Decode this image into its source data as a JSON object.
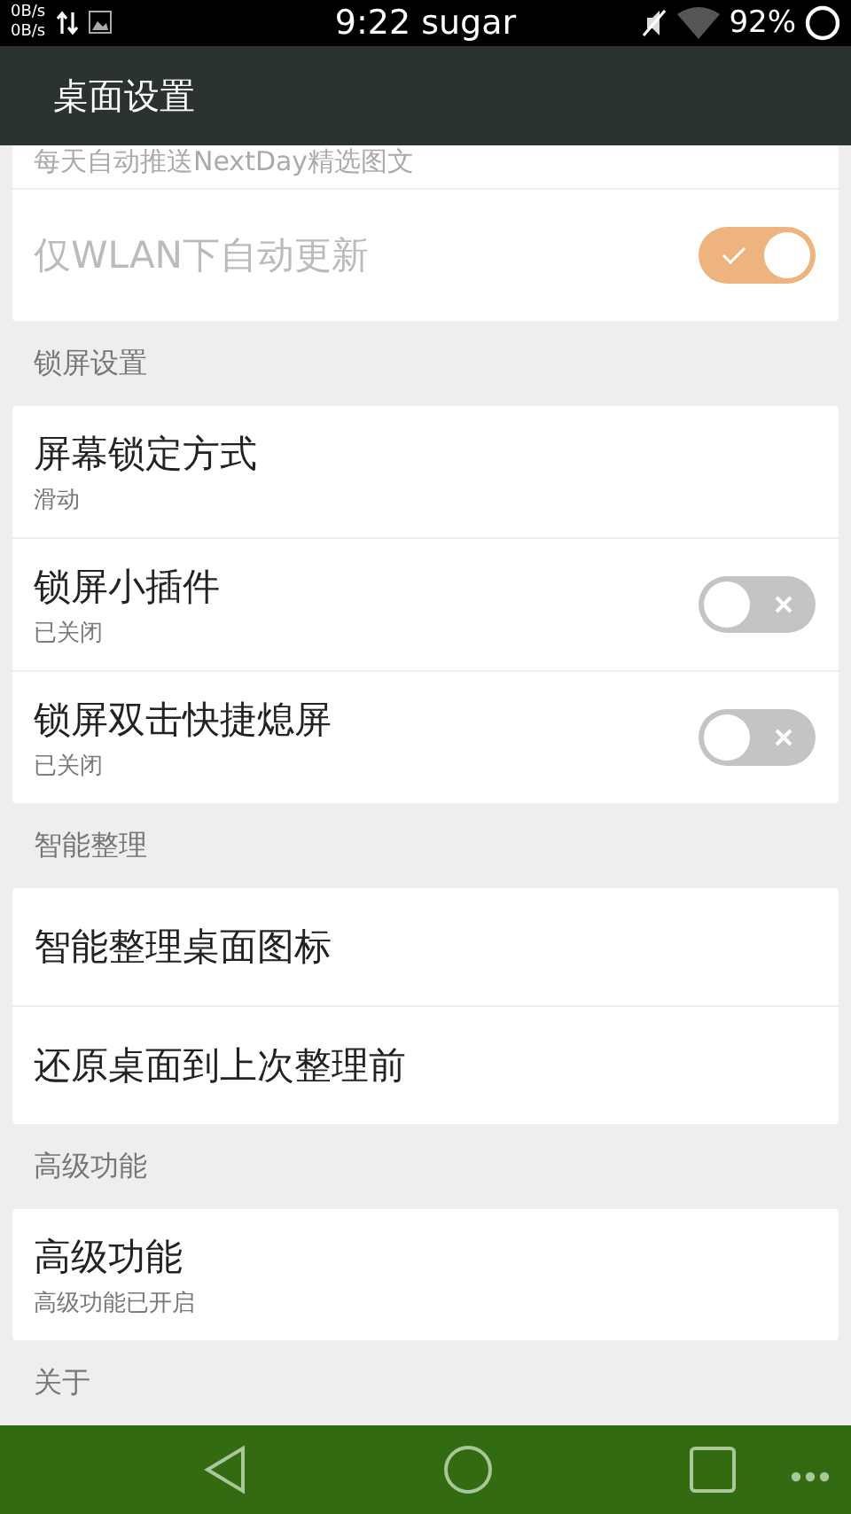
{
  "status_bar": {
    "up_speed": "0B/s",
    "down_speed": "0B/s",
    "time": "9:22 sugar",
    "battery": "92%"
  },
  "app_bar": {
    "title": "桌面设置"
  },
  "sections": [
    {
      "items": [
        {
          "kind": "subtitle_only",
          "subtitle": "每天自动推送NextDay精选图文"
        },
        {
          "kind": "toggle",
          "title": "仅WLAN下自动更新",
          "on": true,
          "disabled": true
        }
      ]
    },
    {
      "header": "锁屏设置",
      "items": [
        {
          "kind": "plain",
          "title": "屏幕锁定方式",
          "subtitle": "滑动"
        },
        {
          "kind": "toggle",
          "title": "锁屏小插件",
          "subtitle": "已关闭",
          "on": false,
          "disabled": false
        },
        {
          "kind": "toggle",
          "title": "锁屏双击快捷熄屏",
          "subtitle": "已关闭",
          "on": false,
          "disabled": false
        }
      ]
    },
    {
      "header": "智能整理",
      "items": [
        {
          "kind": "plain",
          "title": "智能整理桌面图标"
        },
        {
          "kind": "plain",
          "title": "还原桌面到上次整理前"
        }
      ]
    },
    {
      "header": "高级功能",
      "items": [
        {
          "kind": "plain",
          "title": "高级功能",
          "subtitle": "高级功能已开启"
        }
      ]
    },
    {
      "header": "关于"
    }
  ]
}
